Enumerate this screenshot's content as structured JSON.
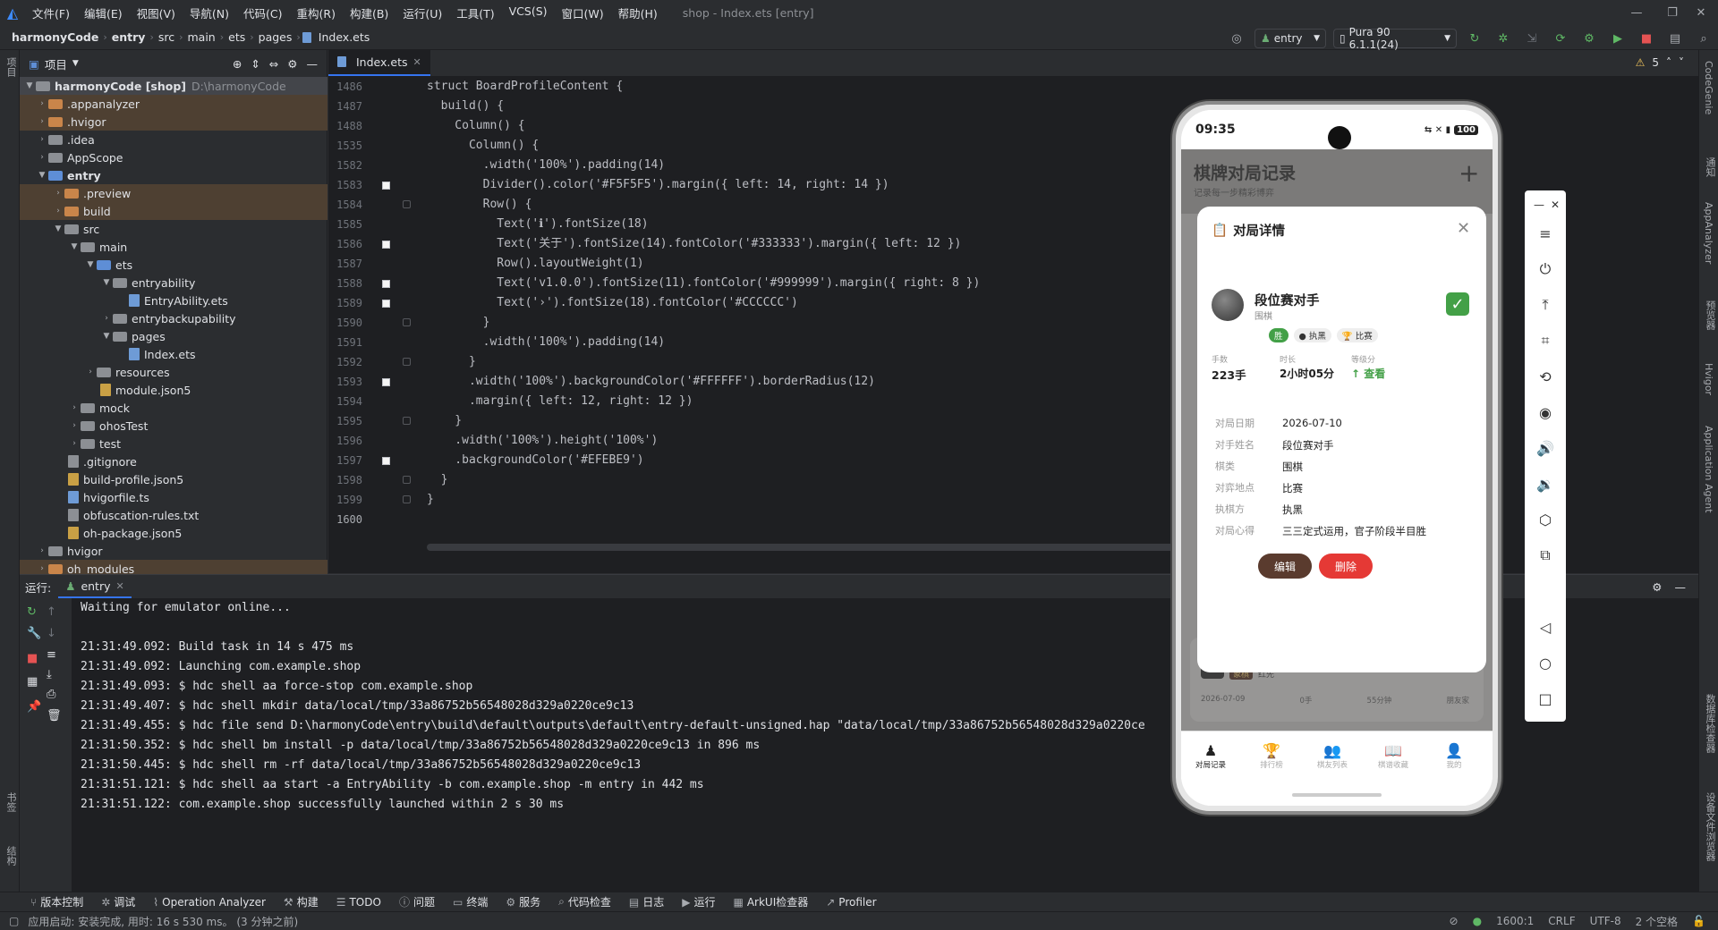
{
  "menubar": {
    "items": [
      "文件(F)",
      "编辑(E)",
      "视图(V)",
      "导航(N)",
      "代码(C)",
      "重构(R)",
      "构建(B)",
      "运行(U)",
      "工具(T)",
      "VCS(S)",
      "窗口(W)",
      "帮助(H)"
    ],
    "title": "shop - Index.ets [entry]"
  },
  "breadcrumb": [
    "harmonyCode",
    "entry",
    "src",
    "main",
    "ets",
    "pages",
    "Index.ets"
  ],
  "toolbar": {
    "module": "entry",
    "device": "Pura 90 6.1.1(24)"
  },
  "project_panel": {
    "title": "项目",
    "root_name": "harmonyCode [shop]",
    "root_path": "D:\\harmonyCode",
    "items": [
      ".appanalyzer",
      ".hvigor",
      ".idea",
      "AppScope",
      "entry",
      ".preview",
      "build",
      "src",
      "main",
      "ets",
      "entryability",
      "EntryAbility.ets",
      "entrybackupability",
      "pages",
      "Index.ets",
      "resources",
      "module.json5",
      "mock",
      "ohosTest",
      "test",
      ".gitignore",
      "build-profile.json5",
      "hvigorfile.ts",
      "obfuscation-rules.txt",
      "oh-package.json5",
      "hvigor",
      "oh_modules"
    ]
  },
  "editor": {
    "tab": "Index.ets",
    "warnings": "5",
    "line_numbers": [
      "1486",
      "1487",
      "1488",
      "1535",
      "1582",
      "1583",
      "1584",
      "1585",
      "1586",
      "1587",
      "1588",
      "1589",
      "1590",
      "1591",
      "1592",
      "1593",
      "1594",
      "1595",
      "1596",
      "1597",
      "1598",
      "1599",
      "1600"
    ],
    "code_lines": [
      "struct BoardProfileContent {",
      "  build() {",
      "    Column() {",
      "      Column() {",
      "        .width('100%').padding(14)",
      "        Divider().color('#F5F5F5').margin({ left: 14, right: 14 })",
      "        Row() {",
      "          Text('ℹ').fontSize(18)",
      "          Text('关于').fontSize(14).fontColor('#333333').margin({ left: 12 })",
      "          Row().layoutWeight(1)",
      "          Text('v1.0.0').fontSize(11).fontColor('#999999').margin({ right: 8 })",
      "          Text('›').fontSize(18).fontColor('#CCCCCC')",
      "        }",
      "        .width('100%').padding(14)",
      "      }",
      "      .width('100%').backgroundColor('#FFFFFF').borderRadius(12)",
      "      .margin({ left: 12, right: 12 })",
      "    }",
      "    .width('100%').height('100%')",
      "    .backgroundColor('#EFEBE9')",
      "  }",
      "}",
      ""
    ]
  },
  "run_panel": {
    "label": "运行:",
    "tab": "entry",
    "lines": [
      "Waiting for emulator online...",
      "",
      "21:31:49.092: Build task in 14 s 475 ms",
      "21:31:49.092: Launching com.example.shop",
      "21:31:49.093: $ hdc shell aa force-stop com.example.shop",
      "21:31:49.407: $ hdc shell mkdir data/local/tmp/33a86752b56548028d329a0220ce9c13",
      "21:31:49.455: $ hdc file send D:\\harmonyCode\\entry\\build\\default\\outputs\\default\\entry-default-unsigned.hap \"data/local/tmp/33a86752b56548028d329a0220ce",
      "21:31:50.352: $ hdc shell bm install -p data/local/tmp/33a86752b56548028d329a0220ce9c13 in 896 ms",
      "21:31:50.445: $ hdc shell rm -rf data/local/tmp/33a86752b56548028d329a0220ce9c13",
      "21:31:51.121: $ hdc shell aa start -a EntryAbility -b com.example.shop -m entry in 442 ms",
      "21:31:51.122: com.example.shop successfully launched within 2 s 30 ms"
    ]
  },
  "bottom_tools": [
    "版本控制",
    "调试",
    "Operation Analyzer",
    "构建",
    "TODO",
    "问题",
    "终端",
    "服务",
    "代码检查",
    "日志",
    "运行",
    "ArkUI检查器",
    "Profiler"
  ],
  "status": {
    "message": "应用启动: 安装完成, 用时: 16 s 530 ms。 (3 分钟之前)",
    "position": "1600:1",
    "line_sep": "CRLF",
    "encoding": "UTF-8",
    "indent": "2 个空格"
  },
  "left_stripe": [
    "项目",
    "书签",
    "结构"
  ],
  "right_stripe": [
    "CodeGenie",
    "通知",
    "AppAnalyzer",
    "预览器",
    "Hvigor",
    "Application Agent",
    "设备文件浏览器",
    "数据库检查器"
  ],
  "phone": {
    "time": "09:35",
    "battery": "100",
    "app_title": "棋牌对局记录",
    "app_subtitle": "记录每一步精彩博弈",
    "dialog": {
      "title": "对局详情",
      "opponent": "段位赛对手",
      "game": "围棋",
      "tags": [
        "胜",
        "执黑",
        "比赛"
      ],
      "stats": [
        {
          "label": "手数",
          "value": "223手"
        },
        {
          "label": "时长",
          "value": "2小时05分"
        },
        {
          "label": "等级分",
          "value": "↑ 查看"
        }
      ],
      "rows": [
        {
          "label": "对局日期",
          "value": "2026-07-10"
        },
        {
          "label": "对手姓名",
          "value": "段位赛对手"
        },
        {
          "label": "棋类",
          "value": "围棋"
        },
        {
          "label": "对弈地点",
          "value": "比赛"
        },
        {
          "label": "执棋方",
          "value": "执黑"
        },
        {
          "label": "对局心得",
          "value": "三三定式运用，官子阶段半目胜"
        }
      ],
      "edit": "编辑",
      "delete": "删除"
    },
    "behind_card": {
      "tags": [
        "象棋",
        "红先"
      ],
      "date": "2026-07-09",
      "moves": "0手",
      "duration": "55分钟",
      "place": "朋友家",
      "score": "+8"
    },
    "tabs": [
      "对局记录",
      "排行榜",
      "棋友列表",
      "棋谱收藏",
      "我的"
    ]
  },
  "colors": {
    "accent": "#3574f0",
    "edit_btn": "#5a3b2e",
    "delete_btn": "#e53935",
    "win_green": "#43a047"
  }
}
